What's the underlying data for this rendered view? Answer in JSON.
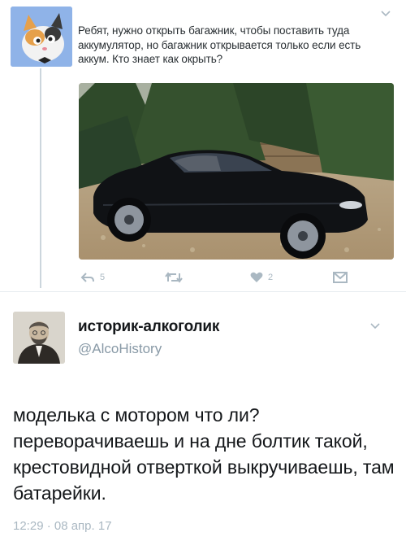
{
  "first_tweet": {
    "text": "Ребят, нужно открыть багажник, чтобы поставить туда аккумулятор, но багажник открывается только если есть аккум. Кто знает как окрыть?",
    "actions": {
      "reply_count": "5",
      "like_count": "2"
    },
    "icons": [
      "cat-avatar",
      "reply-icon",
      "retweet-icon",
      "like-icon",
      "dm-icon",
      "chevron-down-icon"
    ]
  },
  "second_tweet": {
    "display_name": "историк-алкоголик",
    "handle": "@AlcoHistory",
    "text": "моделька с мотором что ли? переворачиваешь и на дне болтик такой, крестовидной отверткой выкручиваешь, там батарейки.",
    "timestamp": "12:29 · 08 апр. 17"
  },
  "colors": {
    "secondary_text": "#8899a6",
    "icon_gray": "#aab8c2",
    "thread_line": "#ccd6dd",
    "car_black": "#101215"
  }
}
